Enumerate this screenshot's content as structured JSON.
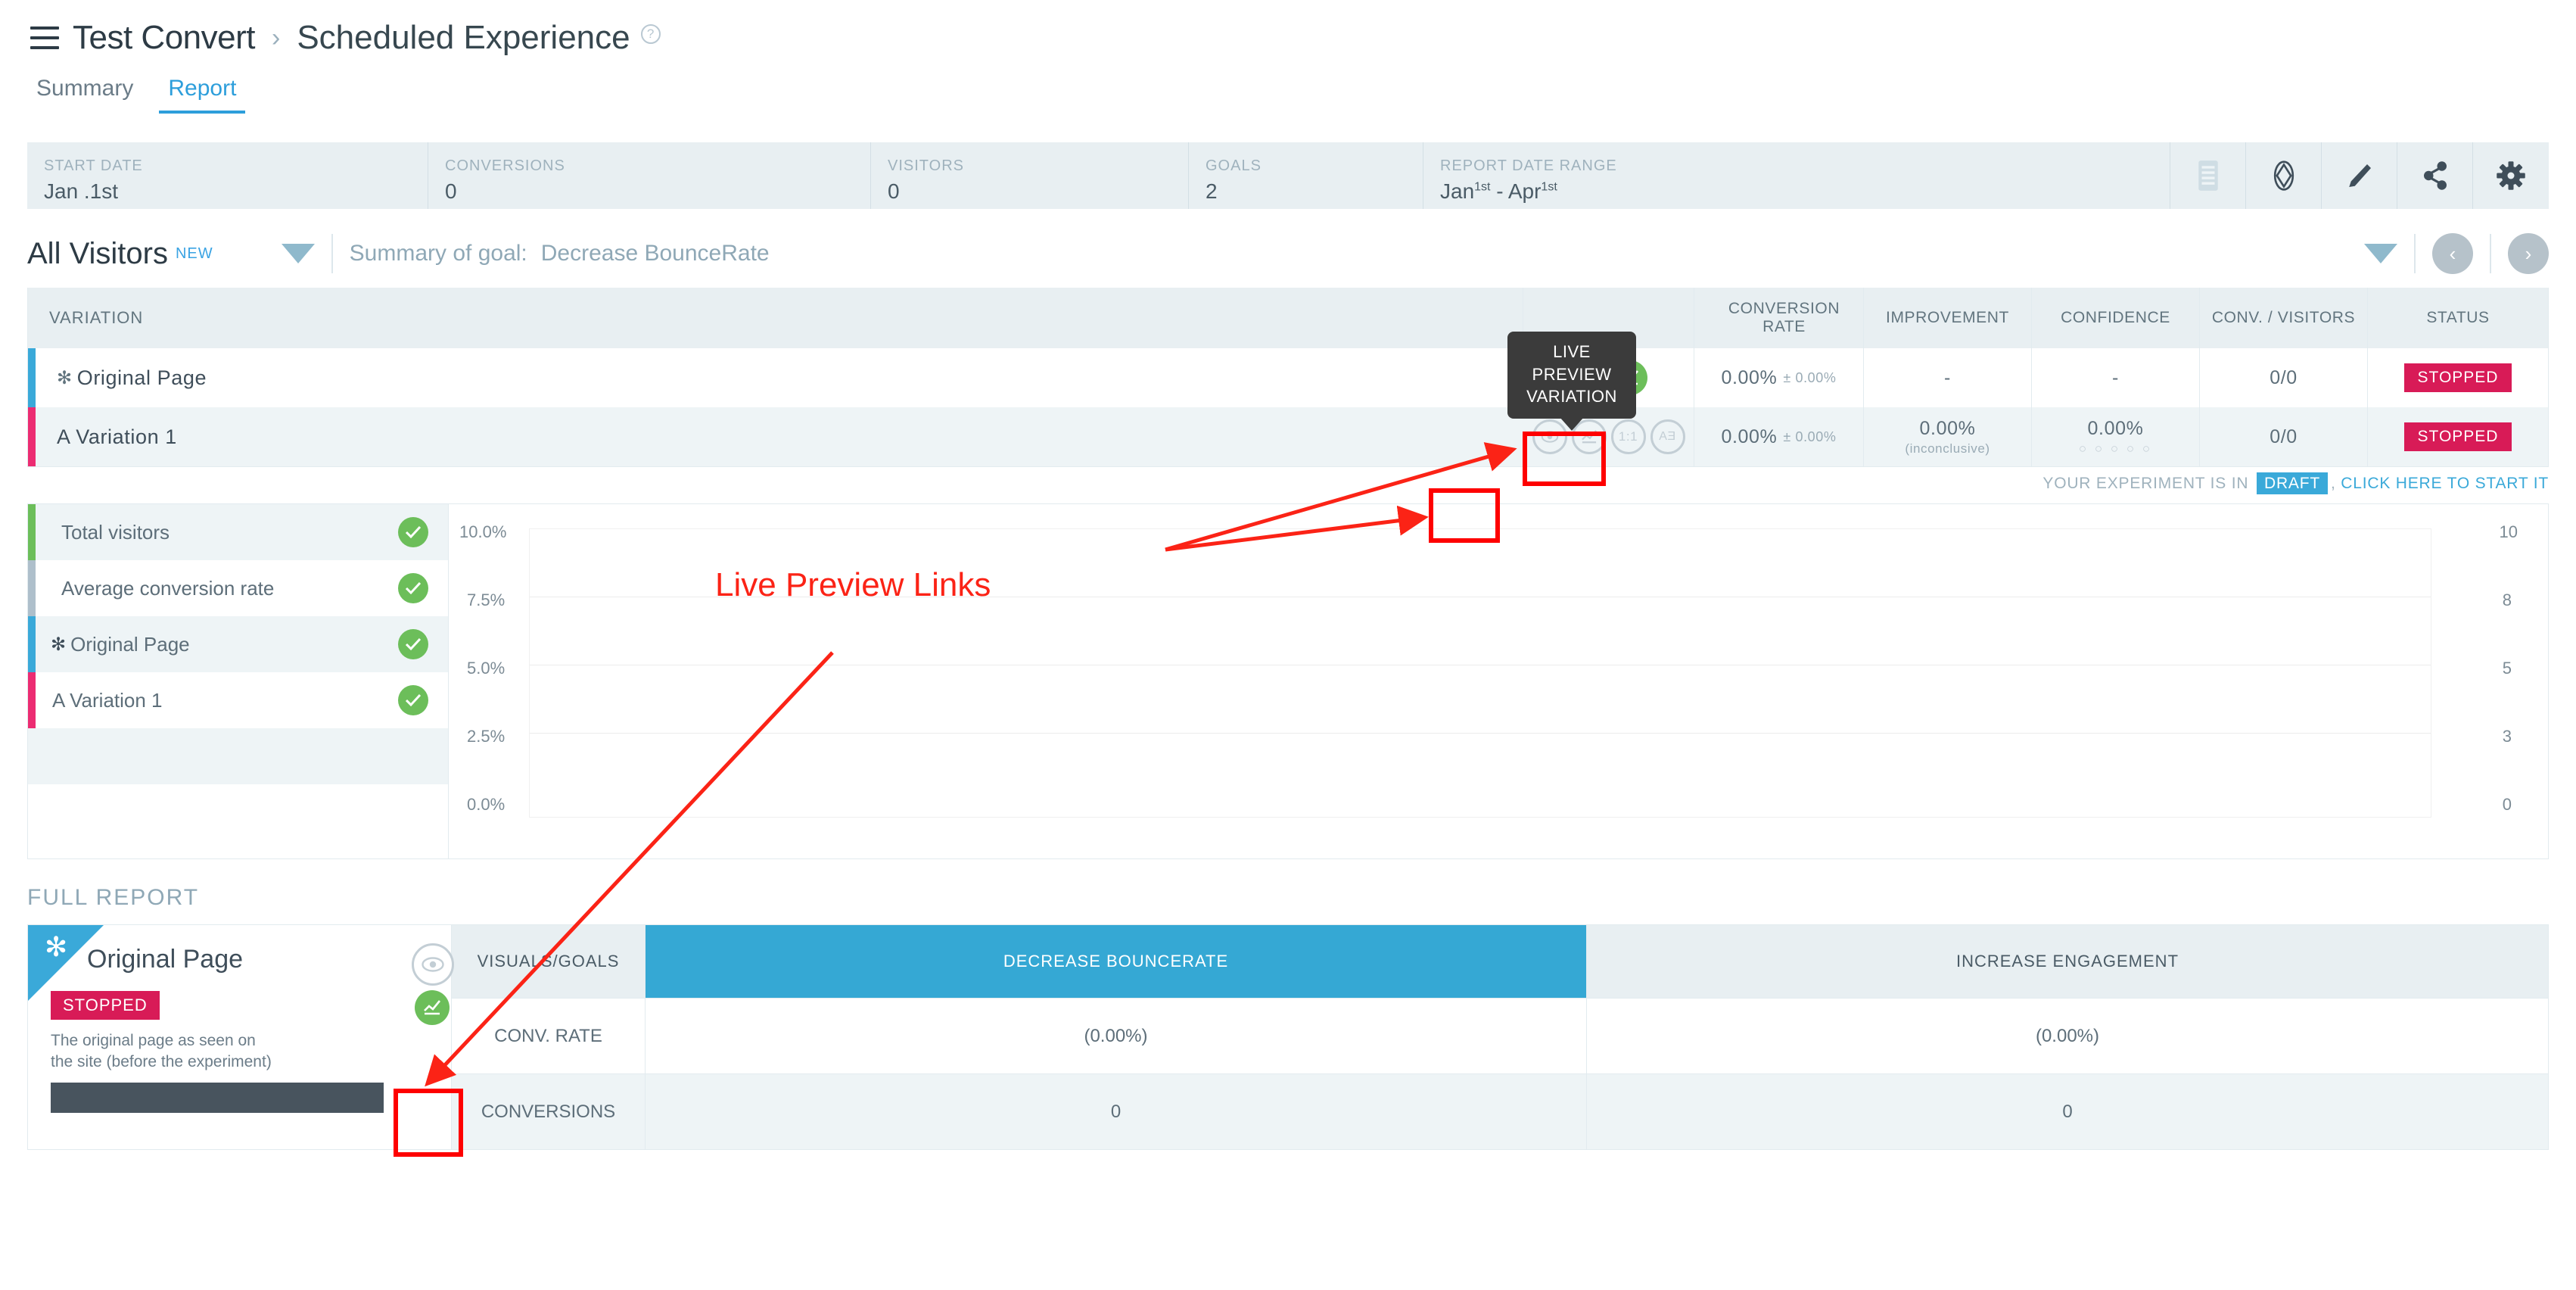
{
  "header": {
    "menu_icon": "hamburger-icon",
    "breadcrumb_root": "Test Convert",
    "breadcrumb_sep": "›",
    "breadcrumb_current": "Scheduled Experience",
    "help_icon": "?"
  },
  "tabs": [
    {
      "label": "Summary",
      "active": false
    },
    {
      "label": "Report",
      "active": true
    }
  ],
  "stats": [
    {
      "label": "START DATE",
      "value": "Jan .1st"
    },
    {
      "label": "CONVERSIONS",
      "value": "0"
    },
    {
      "label": "VISITORS",
      "value": "0"
    },
    {
      "label": "GOALS",
      "value": "2"
    }
  ],
  "date_range": {
    "label": "REPORT DATE RANGE",
    "value_from": "Jan",
    "value_from_sup": "1st",
    "value_dash": "-",
    "value_to": "Apr",
    "value_to_sup": "1st"
  },
  "toolbar_icons": [
    {
      "name": "notes-icon",
      "title": "Notes"
    },
    {
      "name": "code-icon",
      "title": "Code"
    },
    {
      "name": "edit-icon",
      "title": "Edit"
    },
    {
      "name": "share-icon",
      "title": "Share"
    },
    {
      "name": "gear-icon",
      "title": "Settings"
    }
  ],
  "summary": {
    "segment": "All Visitors",
    "new_badge": "NEW",
    "goal_prefix": "Summary of goal:",
    "goal_name": "Decrease BounceRate",
    "prev_label": "‹",
    "next_label": "›"
  },
  "variation_table": {
    "columns": [
      "VARIATION",
      "",
      "CONVERSION RATE",
      "IMPROVEMENT",
      "CONFIDENCE",
      "CONV. / VISITORS",
      "STATUS"
    ],
    "col_conversion_rate": "CONVERSION RATE",
    "col_improvement": "IMPROVEMENT",
    "col_confidence": "CONFIDENCE",
    "col_conv_visitors": "CONV. / VISITORS",
    "col_status": "STATUS",
    "col_variation": "VARIATION",
    "rows": [
      {
        "star": "✻",
        "name": "Original Page",
        "conversion_rate": "0.00%",
        "conversion_rate_margin": "± 0.00%",
        "improvement": "-",
        "improvement_sub": "",
        "confidence": "-",
        "confidence_dots": "",
        "conv_visitors": "0/0",
        "status": "STOPPED"
      },
      {
        "star": "",
        "name": "A Variation 1",
        "conversion_rate": "0.00%",
        "conversion_rate_margin": "± 0.00%",
        "improvement": "0.00%",
        "improvement_sub": "(inconclusive)",
        "confidence": "0.00%",
        "confidence_dots": "○ ○ ○ ○ ○",
        "conv_visitors": "0/0",
        "status": "STOPPED"
      }
    ]
  },
  "tooltip": {
    "line1": "LIVE",
    "line2": "PREVIEW",
    "line3": "VARIATION"
  },
  "annotation": {
    "label": "Live Preview Links",
    "color": "#fb2316"
  },
  "draft_notice": {
    "prefix": "YOUR EXPERIMENT IS IN",
    "badge": "DRAFT",
    "comma": ",",
    "link": "CLICK HERE TO START IT"
  },
  "chart_legend": [
    {
      "label": "Total visitors",
      "color": "#6cbe5a",
      "checked": true
    },
    {
      "label": "Average conversion rate",
      "color": "#aebfcb",
      "checked": true
    },
    {
      "label": "Original Page",
      "color": "#3aa9d9",
      "checked": true,
      "star": "✻"
    },
    {
      "label": "A Variation 1",
      "color": "#ec2c72",
      "checked": true
    }
  ],
  "full_report": {
    "section_title": "FULL REPORT",
    "variation_title": "Original Page",
    "variation_star": "✻",
    "status": "STOPPED",
    "description": "The original page as seen on the site (before the experiment)",
    "preview_icon": "eye-icon",
    "chart_icon": "trend-icon",
    "columns": [
      "VISUALS/GOALS",
      "DECREASE BOUNCERATE",
      "INCREASE ENGAGEMENT"
    ],
    "rows": [
      {
        "label": "CONV. RATE",
        "values": [
          "(0.00%)",
          "(0.00%)"
        ]
      },
      {
        "label": "CONVERSIONS",
        "values": [
          "0",
          "0"
        ]
      }
    ]
  },
  "chart_data": {
    "type": "line",
    "title": "",
    "xlabel": "",
    "ylabel": "",
    "left_axis_ticks": [
      "10.0%",
      "7.5%",
      "5.0%",
      "2.5%",
      "0.0%"
    ],
    "right_axis_ticks": [
      "10",
      "8",
      "5",
      "3",
      "0"
    ],
    "ylim": [
      0,
      10
    ],
    "y2lim": [
      0,
      10
    ],
    "grid": true,
    "legend_position": "left",
    "series": [
      {
        "name": "Total visitors",
        "color": "#6cbe5a",
        "values": []
      },
      {
        "name": "Average conversion rate",
        "color": "#aebfcb",
        "values": []
      },
      {
        "name": "Original Page",
        "color": "#3aa9d9",
        "values": []
      },
      {
        "name": "A Variation 1",
        "color": "#ec2c72",
        "values": []
      }
    ]
  },
  "colors": {
    "accent_blue": "#3aa9d9",
    "accent_pink": "#ec2c72",
    "status_red": "#d81b57",
    "green": "#6cbe5a",
    "annotation_red": "#fb2316",
    "panel_bg": "#e8eff2"
  }
}
